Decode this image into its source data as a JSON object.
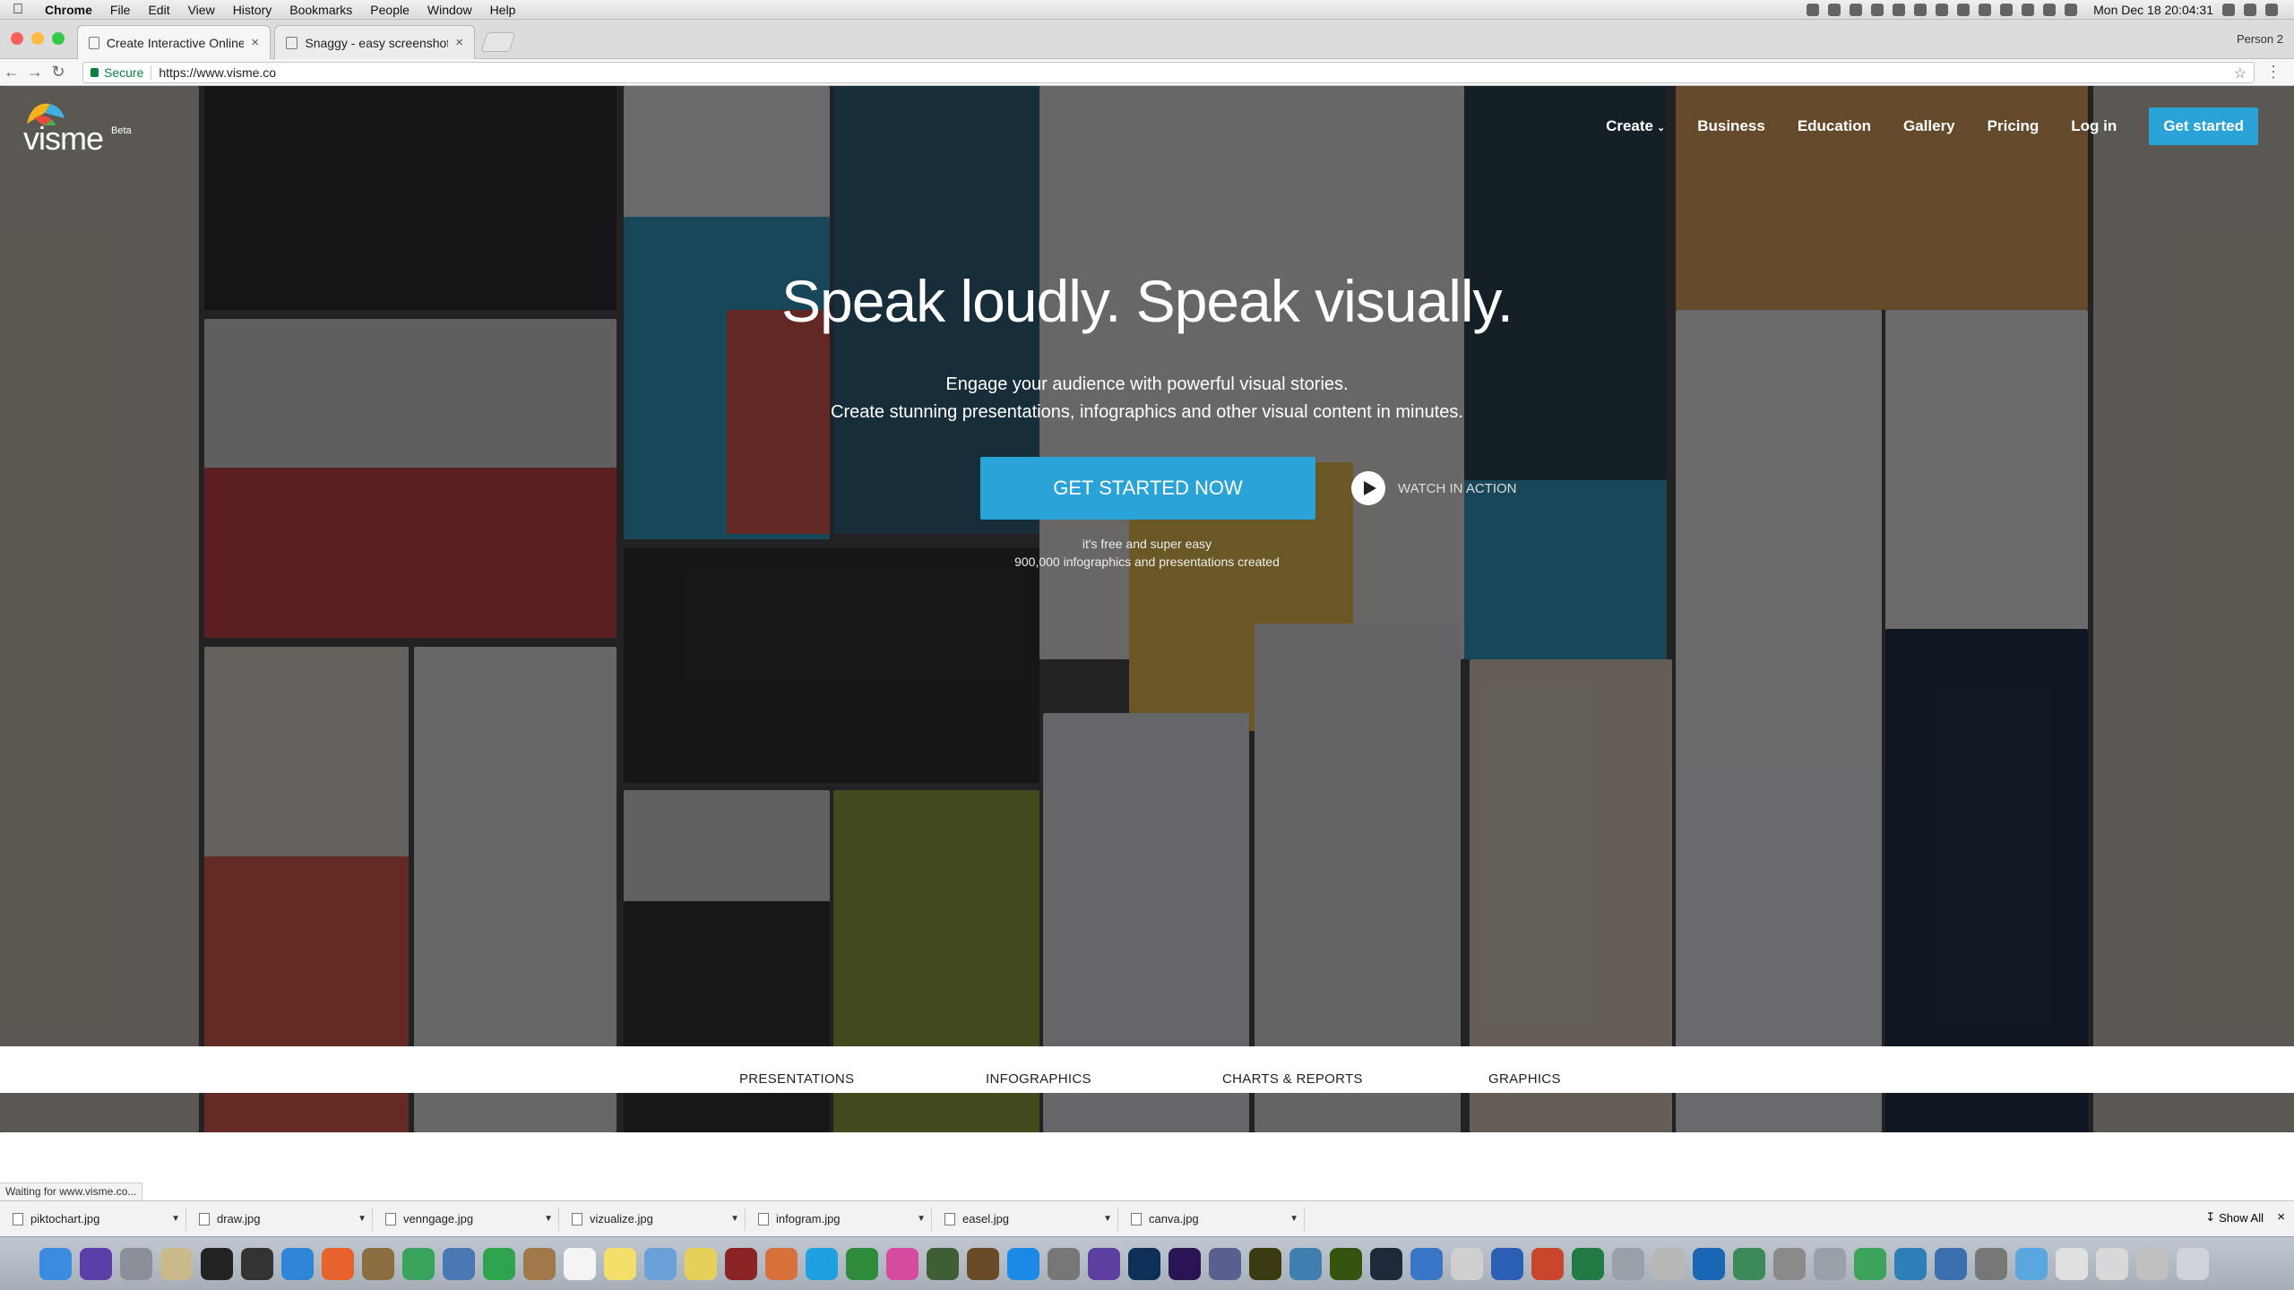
{
  "menubar": {
    "apple": "",
    "app": "Chrome",
    "items": [
      "File",
      "Edit",
      "View",
      "History",
      "Bookmarks",
      "People",
      "Window",
      "Help"
    ],
    "clock": "Mon Dec 18  20:04:31"
  },
  "browser": {
    "tabs": [
      {
        "title": "Create Interactive Online Pres",
        "active": true
      },
      {
        "title": "Snaggy - easy screenshots",
        "active": false
      }
    ],
    "tab_close": "×",
    "person": "Person 2",
    "secure_label": "Secure",
    "url": "https://www.visme.co",
    "nav": {
      "back": "←",
      "forward": "→",
      "reload": "↻"
    },
    "star": "☆",
    "menu": "⋮"
  },
  "site": {
    "logo": "visme",
    "beta": "Beta",
    "nav": {
      "create": "Create",
      "business": "Business",
      "education": "Education",
      "gallery": "Gallery",
      "pricing": "Pricing",
      "login": "Log in",
      "get_started": "Get started"
    },
    "hero": {
      "title": "Speak loudly. Speak visually.",
      "sub1": "Engage your audience with powerful visual stories.",
      "sub2": "Create stunning presentations, infographics and other visual content in minutes.",
      "cta": "GET STARTED NOW",
      "watch": "WATCH IN ACTION",
      "note1": "it's free and super easy",
      "note2": "900,000 infographics and presentations created"
    },
    "bottom_tabs": [
      "PRESENTATIONS",
      "INFOGRAPHICS",
      "CHARTS & REPORTS",
      "GRAPHICS"
    ],
    "status": "Waiting for www.visme.co..."
  },
  "downloads": {
    "files": [
      "piktochart.jpg",
      "draw.jpg",
      "venngage.jpg",
      "vizualize.jpg",
      "infogram.jpg",
      "easel.jpg",
      "canva.jpg"
    ],
    "show_all": "Show All",
    "close": "×"
  },
  "dock": {
    "apps": [
      {
        "icon": "finder-icon",
        "color": "#3b8be0"
      },
      {
        "icon": "siri-icon",
        "color": "#5a3fa8"
      },
      {
        "icon": "launchpad-icon",
        "color": "#8a8f98"
      },
      {
        "icon": "notes-icon",
        "color": "#c9b98b"
      },
      {
        "icon": "terminal-icon",
        "color": "#222222"
      },
      {
        "icon": "calculator-icon",
        "color": "#333333"
      },
      {
        "icon": "safari-icon",
        "color": "#2f86d9"
      },
      {
        "icon": "firefox-icon",
        "color": "#e8632b"
      },
      {
        "icon": "stack-icon",
        "color": "#8b6d3f"
      },
      {
        "icon": "chrome-icon",
        "color": "#3aa35b"
      },
      {
        "icon": "photos-icon",
        "color": "#4a78b5"
      },
      {
        "icon": "messages-icon",
        "color": "#2ea44f"
      },
      {
        "icon": "contacts-icon",
        "color": "#a0784a"
      },
      {
        "icon": "calendar-icon",
        "color": "#f4f4f4"
      },
      {
        "icon": "notes2-icon",
        "color": "#f3df6a"
      },
      {
        "icon": "preview-icon",
        "color": "#6aa0d8"
      },
      {
        "icon": "stickies-icon",
        "color": "#e7cf5b"
      },
      {
        "icon": "photobooth-icon",
        "color": "#8b2525"
      },
      {
        "icon": "photos2-icon",
        "color": "#d8703c"
      },
      {
        "icon": "skype-icon",
        "color": "#1fa0e0"
      },
      {
        "icon": "numbers-icon",
        "color": "#2d8b3a"
      },
      {
        "icon": "itunes-icon",
        "color": "#d64aa0"
      },
      {
        "icon": "game-icon",
        "color": "#3d5f35"
      },
      {
        "icon": "brush-icon",
        "color": "#6b4a2a"
      },
      {
        "icon": "appstore-icon",
        "color": "#1b89e6"
      },
      {
        "icon": "settings-icon",
        "color": "#777777"
      },
      {
        "icon": "imovie-icon",
        "color": "#5c3fa0"
      },
      {
        "icon": "photoshop-icon",
        "color": "#0e2f57"
      },
      {
        "icon": "aftereffects-icon",
        "color": "#2b1456"
      },
      {
        "icon": "php-icon",
        "color": "#5a5f8f"
      },
      {
        "icon": "muse-icon",
        "color": "#3b3b12"
      },
      {
        "icon": "elephant-icon",
        "color": "#3f7fb0"
      },
      {
        "icon": "dreamweaver-icon",
        "color": "#35550f"
      },
      {
        "icon": "bracket-icon",
        "color": "#1e2a3a"
      },
      {
        "icon": "word-icon",
        "color": "#3a76c7"
      },
      {
        "icon": "paper-icon",
        "color": "#cfcfcf"
      },
      {
        "icon": "word2-icon",
        "color": "#2b5fb3"
      },
      {
        "icon": "powerpoint-icon",
        "color": "#c9452c"
      },
      {
        "icon": "excel-icon",
        "color": "#1f7b42"
      },
      {
        "icon": "help-icon",
        "color": "#9aa0a8"
      },
      {
        "icon": "archive-icon",
        "color": "#b8b8b8"
      },
      {
        "icon": "teamviewer-icon",
        "color": "#1966b5"
      },
      {
        "icon": "globe-icon",
        "color": "#3c8a5a"
      },
      {
        "icon": "tools-icon",
        "color": "#8a8a8a"
      },
      {
        "icon": "help2-icon",
        "color": "#9aa0a8"
      },
      {
        "icon": "magnifier-icon",
        "color": "#3da35a"
      },
      {
        "icon": "chart-icon",
        "color": "#2d7fb8"
      },
      {
        "icon": "sync-icon",
        "color": "#3b6fb0"
      },
      {
        "icon": "scanner-icon",
        "color": "#777777"
      },
      {
        "icon": "folder-icon",
        "color": "#5aa7e0"
      },
      {
        "icon": "doc-icon",
        "color": "#e0e0e0"
      },
      {
        "icon": "window-icon",
        "color": "#d8d8d8"
      },
      {
        "icon": "screen-icon",
        "color": "#c0c0c0"
      },
      {
        "icon": "trash-icon",
        "color": "#d0d4d8"
      }
    ]
  },
  "colors": {
    "accent": "#2aa3d8",
    "overlay": "#141416"
  }
}
